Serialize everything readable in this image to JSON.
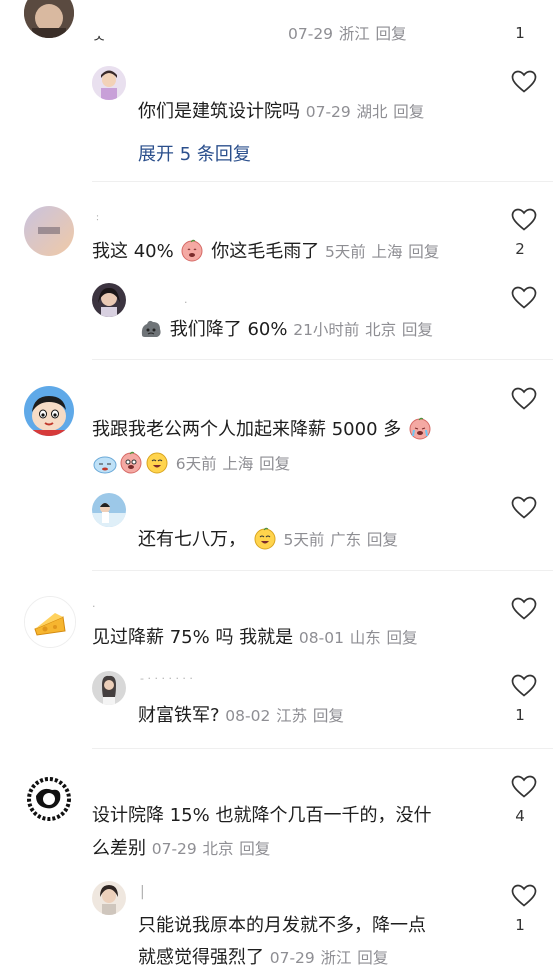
{
  "thread0": {
    "main_tail": {
      "text": "",
      "date": "07-29",
      "location": "浙江",
      "reply": "回复",
      "likes": "1"
    },
    "sub1": {
      "text": "你们是建筑设计院吗",
      "date": "07-29",
      "location": "湖北",
      "reply": "回复"
    },
    "expand_label": "展开 5 条回复"
  },
  "thread1": {
    "main": {
      "text_a": "我这 40%",
      "text_b": " 你这毛毛雨了",
      "date": "5天前",
      "location": "上海",
      "reply": "回复",
      "likes": "2"
    },
    "sub1": {
      "text": "我们降了 60%",
      "date": "21小时前",
      "location": "北京",
      "reply": "回复"
    }
  },
  "thread2": {
    "main": {
      "text": "我跟我老公两个人加起来降薪 5000 多",
      "date": "6天前",
      "location": "上海",
      "reply": "回复"
    },
    "sub1": {
      "text": "还有七八万，",
      "date": "5天前",
      "location": "广东",
      "reply": "回复"
    }
  },
  "thread3": {
    "main": {
      "text": "见过降薪 75% 吗 我就是",
      "date": "08-01",
      "location": "山东",
      "reply": "回复"
    },
    "sub1": {
      "text": "财富铁军?",
      "date": "08-02",
      "location": "江苏",
      "reply": "回复",
      "likes": "1"
    }
  },
  "thread4": {
    "main": {
      "line1": "设计院降 15% 也就降个几百一千的，没什",
      "line2": "么差别",
      "date": "07-29",
      "location": "北京",
      "reply": "回复",
      "likes": "4"
    },
    "sub1": {
      "line1": "只能说我原本的月发就不多，降一点",
      "line2": "就感觉得强烈了",
      "date": "07-29",
      "location": "浙江",
      "reply": "回复",
      "likes": "1"
    }
  },
  "colors": {
    "meta": "#8e8e93",
    "link": "#2b4f8c",
    "text": "#1e1e1e"
  },
  "icons": {
    "like": "heart-outline-icon"
  }
}
